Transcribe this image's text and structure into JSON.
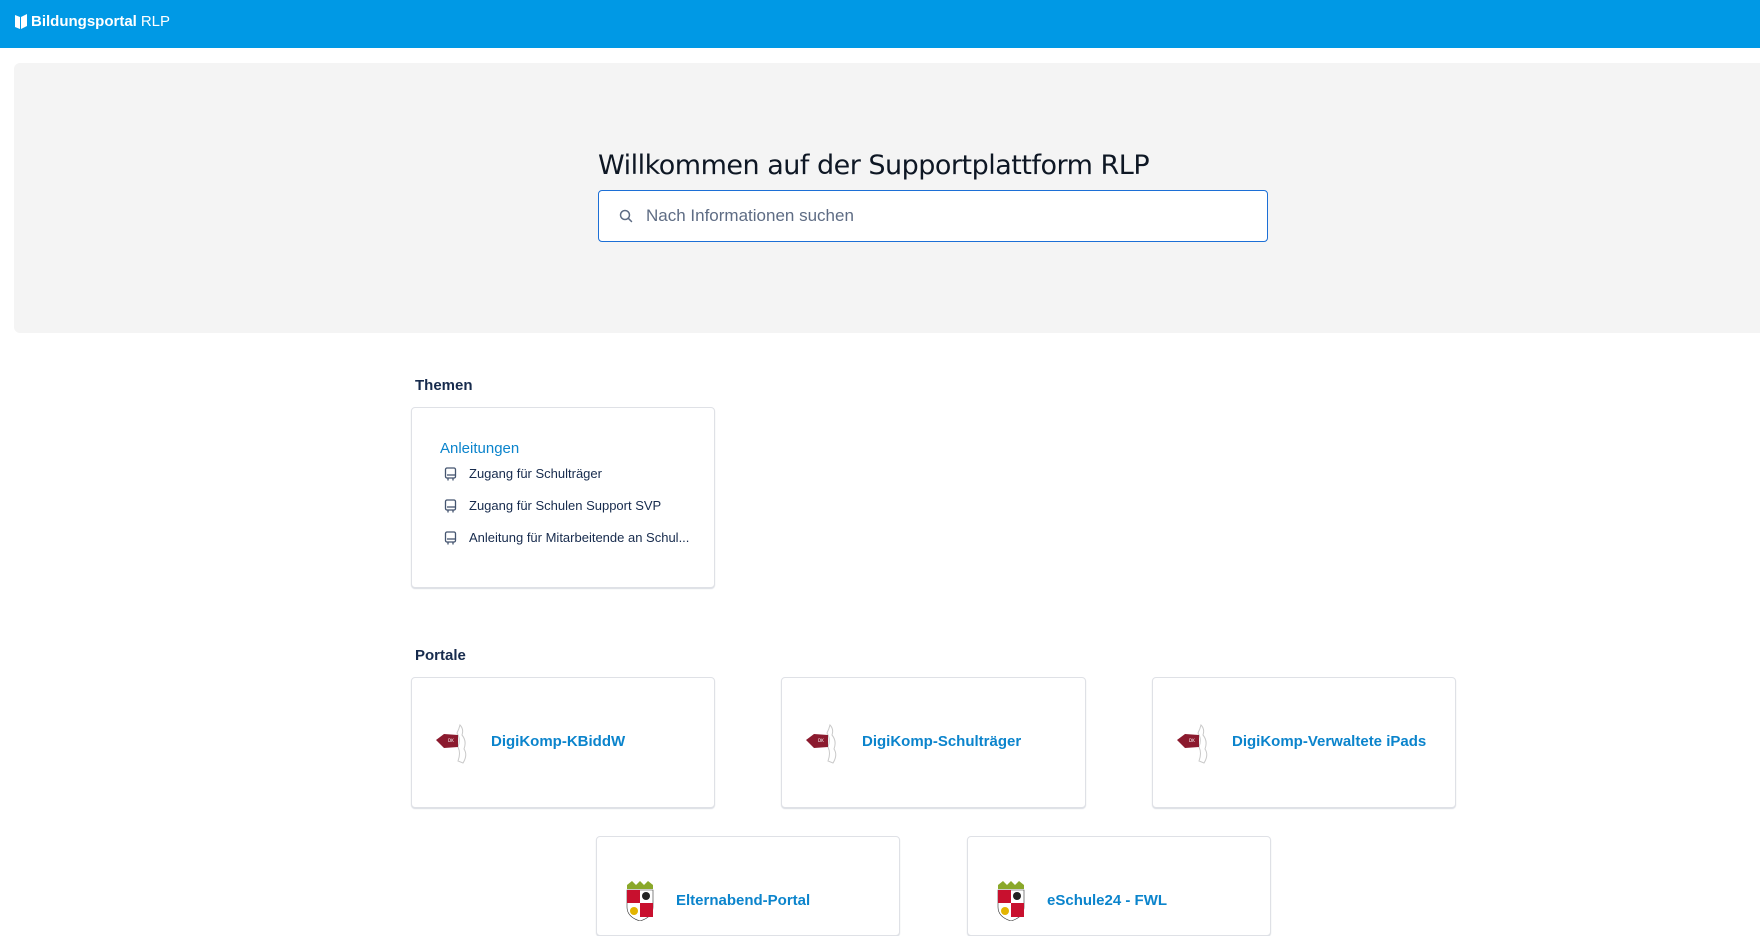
{
  "header": {
    "brand_bold": "Bildungsportal",
    "brand_suffix": "RLP",
    "background": "#0099e5",
    "logo_icon": "book-shield-icon"
  },
  "hero": {
    "title": "Willkommen auf der Supportplattform RLP",
    "search": {
      "placeholder": "Nach Informationen suchen",
      "value": "",
      "icon": "search-icon"
    }
  },
  "themen": {
    "label": "Themen",
    "card": {
      "title": "Anleitungen",
      "items": [
        {
          "label": "Zugang für Schulträger",
          "icon": "book-icon"
        },
        {
          "label": "Zugang für Schulen Support SVP",
          "icon": "book-icon"
        },
        {
          "label": "Anleitung für Mitarbeitende an Schul...",
          "icon": "book-icon"
        }
      ]
    }
  },
  "portale": {
    "label": "Portale",
    "items": [
      {
        "name": "DigiKomp-KBiddW",
        "icon": "digikomp-logo-icon"
      },
      {
        "name": "DigiKomp-Schulträger",
        "icon": "digikomp-logo-icon"
      },
      {
        "name": "DigiKomp-Verwaltete iPads",
        "icon": "digikomp-logo-icon"
      },
      {
        "name": "Elternabend-Portal",
        "icon": "rlp-coat-of-arms-icon"
      },
      {
        "name": "eSchule24 - FWL",
        "icon": "rlp-coat-of-arms-icon"
      }
    ]
  },
  "colors": {
    "accent": "#0099e5",
    "link": "#0b84cc",
    "hero_bg": "#f4f4f4",
    "search_border": "#1c6fd6"
  }
}
